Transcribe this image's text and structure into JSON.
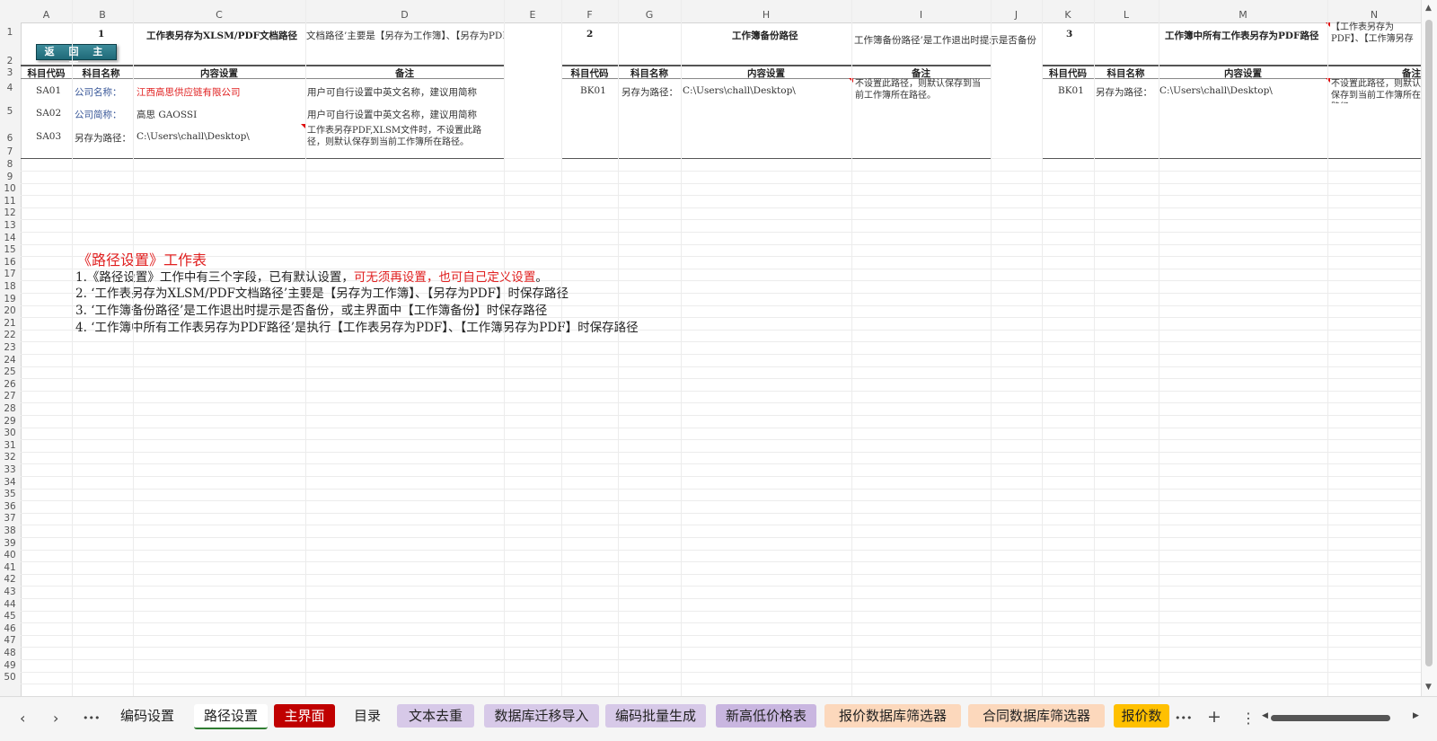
{
  "columns": [
    "A",
    "B",
    "C",
    "D",
    "E",
    "F",
    "G",
    "H",
    "I",
    "J",
    "K",
    "L",
    "M",
    "N"
  ],
  "rows": [
    "1",
    "2",
    "3",
    "4",
    "5",
    "6",
    "7",
    "8",
    "9",
    "10",
    "11",
    "12",
    "13",
    "14",
    "15",
    "16",
    "17",
    "18",
    "19",
    "20",
    "21",
    "22",
    "23",
    "24",
    "25",
    "26",
    "27",
    "28",
    "29",
    "30",
    "31",
    "32",
    "33",
    "34",
    "35",
    "36",
    "37",
    "38",
    "39",
    "40",
    "41",
    "42",
    "43",
    "44",
    "45",
    "46",
    "47",
    "48",
    "49",
    "50"
  ],
  "back_button": "返 回 主 页",
  "sections": {
    "s1": {
      "number": "1",
      "title": "工作表另存为XLSM/PDF文档路径",
      "note": "文档路径’主要是【另存为工作簿】、【另存为PDF】时保存"
    },
    "s2": {
      "number": "2",
      "title": "工作簿备份路径",
      "note": "工作簿备份路径’是工作退出时提示是否备份"
    },
    "s3": {
      "number": "3",
      "title": "工作簿中所有工作表另存为PDF路径",
      "note": "【工作表另存为PDF】、【工作簿另存为PDF】时保存路径"
    }
  },
  "table_headers": {
    "code": "科目代码",
    "name": "科目名称",
    "content": "内容设置",
    "remark": "备注"
  },
  "table1": [
    {
      "code": "SA01",
      "name": "公司名称：",
      "content": "江西高思供应链有限公司",
      "remark": "用户可自行设置中英文名称，建议用简称"
    },
    {
      "code": "SA02",
      "name": "公司简称：",
      "content": "高思 GAOSSI",
      "remark": "用户可自行设置中英文名称，建议用简称"
    },
    {
      "code": "SA03",
      "name": "另存为路径：",
      "content": "C:\\Users\\chall\\Desktop\\",
      "remark": "工作表另存PDF,XLSM文件时，不设置此路径，则默认保存到当前工作簿所在路径。"
    }
  ],
  "table2": [
    {
      "code": "BK01",
      "name": "另存为路径：",
      "content": "C:\\Users\\chall\\Desktop\\",
      "remark": "不设置此路径，则默认保存到当前工作簿所在路径。"
    }
  ],
  "table3": [
    {
      "code": "BK01",
      "name": "另存为路径：",
      "content": "C:\\Users\\chall\\Desktop\\",
      "remark": "不设置此路径，则默认保存到当前工作簿所在路径。"
    }
  ],
  "info": {
    "title": "《路径设置》工作表",
    "line1_a": "1.《路径设置》工作中有三个字段，已有默认设置，",
    "line1_b": "可无须再设置，也可自己定义设置",
    "line1_c": "。",
    "line2": "2. ‘工作表另存为XLSM/PDF文档路径’主要是【另存为工作簿】、【另存为PDF】时保存路径",
    "line3": "3. ‘工作簿备份路径’是工作退出时提示是否备份，或主界面中【工作簿备份】时保存路径",
    "line4": "4. ‘工作簿中所有工作表另存为PDF路径’是执行【工作表另存为PDF】、【工作簿另存为PDF】时保存路径"
  },
  "tabs": [
    {
      "label": "编码设置",
      "bg": ""
    },
    {
      "label": "路径设置",
      "bg": "active"
    },
    {
      "label": "主界面",
      "bg": "#c00000"
    },
    {
      "label": "目录",
      "bg": ""
    },
    {
      "label": "文本去重",
      "bg": "#d7c9e8"
    },
    {
      "label": "数据库迁移导入",
      "bg": "#d7c9e8"
    },
    {
      "label": "编码批量生成",
      "bg": "#d7c9e8"
    },
    {
      "label": "新高低价格表",
      "bg": "#c9b6e0"
    },
    {
      "label": "报价数据库筛选器",
      "bg": "#fcd8bc"
    },
    {
      "label": "合同数据库筛选器",
      "bg": "#fcd8bc"
    },
    {
      "label": "报价数",
      "bg": "#ffc000"
    }
  ],
  "tab_nav": {
    "prev": "‹",
    "next": "›",
    "more_left": "•••",
    "more_right": "•••",
    "add": "+",
    "menu": "⋮"
  },
  "colors": {
    "accent_green": "#2f7d32",
    "red_text": "#e02020",
    "blue_text": "#3c5a9a"
  }
}
